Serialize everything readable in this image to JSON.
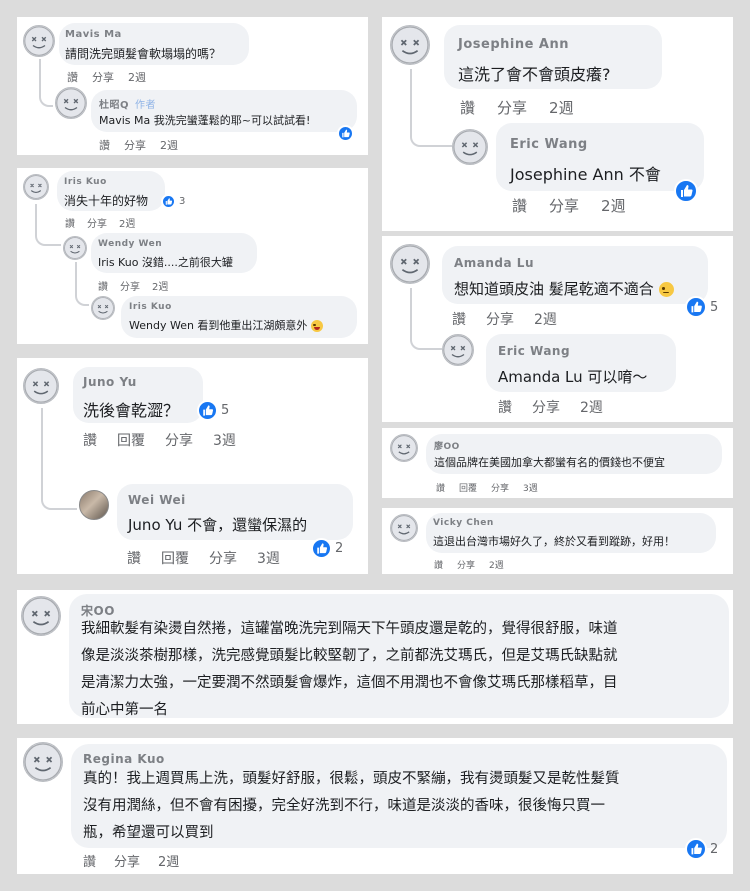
{
  "colors": {
    "accent": "#1877f2",
    "bubble": "#f0f2f5",
    "muted": "#65676b",
    "background": "#dcdcdc"
  },
  "icons": {
    "avatar": "default-avatar-icon",
    "like": "thumbs-up-icon",
    "haha": "laughing-emoji-icon",
    "sad": "sad-emoji-icon"
  },
  "card1": {
    "c1": {
      "name": "Mavis Ma",
      "text": "請問洗完頭髮會軟塌塌的嗎？",
      "like": "讚",
      "share": "分享",
      "time": "2週"
    },
    "c2": {
      "name": "杜昭Q",
      "tag": "作者",
      "text": "Mavis Ma 我洗完蠻蓬鬆的耶~可以試試看!",
      "like": "讚",
      "share": "分享",
      "time": "2週"
    }
  },
  "card2": {
    "c1": {
      "name": "Iris Kuo",
      "text": "消失十年的好物",
      "count": "3",
      "like": "讚",
      "share": "分享",
      "time": "2週"
    },
    "c2": {
      "name": "Wendy Wen",
      "text": "Iris Kuo 沒錯....之前很大罐",
      "like": "讚",
      "share": "分享",
      "time": "2週"
    },
    "c3": {
      "name": "Iris Kuo",
      "text": "Wendy Wen 看到他重出江湖頗意外"
    }
  },
  "card3": {
    "c1": {
      "name": "Juno Yu",
      "text": "洗後會乾澀？",
      "count": "5",
      "like": "讚",
      "reply": "回覆",
      "share": "分享",
      "time": "3週"
    },
    "c2": {
      "name": "Wei Wei",
      "text": "Juno Yu 不會，還蠻保濕的",
      "count": "2",
      "like": "讚",
      "reply": "回覆",
      "share": "分享",
      "time": "3週"
    }
  },
  "card4": {
    "c1": {
      "name": "Josephine Ann",
      "text": "這洗了會不會頭皮癢?",
      "like": "讚",
      "share": "分享",
      "time": "2週"
    },
    "c2": {
      "name": "Eric Wang",
      "text": "Josephine Ann 不會",
      "like": "讚",
      "share": "分享",
      "time": "2週"
    }
  },
  "card5": {
    "c1": {
      "name": "Amanda Lu",
      "text": "想知道頭皮油 髮尾乾適不適合",
      "count": "5",
      "like": "讚",
      "share": "分享",
      "time": "2週"
    },
    "c2": {
      "name": "Eric Wang",
      "text": "Amanda Lu 可以唷～",
      "like": "讚",
      "share": "分享",
      "time": "2週"
    }
  },
  "card6": {
    "c1": {
      "name": "廖OO",
      "text": "這個品牌在美國加拿大都蠻有名的價錢也不便宜",
      "like": "讚",
      "reply": "回覆",
      "share": "分享",
      "time": "3週"
    }
  },
  "card7": {
    "c1": {
      "name": "Vicky Chen",
      "text": "這退出台灣市場好久了，終於又看到蹤跡，好用！",
      "like": "讚",
      "share": "分享",
      "time": "2週"
    }
  },
  "card8": {
    "c1": {
      "name": "宋OO",
      "line1": "我細軟髮有染燙自然捲，這罐當晚洗完到隔天下午頭皮還是乾的，覺得很舒服，味道",
      "line2": "像是淡淡茶樹那樣，洗完感覺頭髮比較堅韌了，之前都洗艾瑪氏，但是艾瑪氏缺點就",
      "line3": "是清潔力太強，一定要潤不然頭髮會爆炸，這個不用潤也不會像艾瑪氏那樣稻草，目",
      "line4": "前心中第一名"
    }
  },
  "card9": {
    "c1": {
      "name": "Regina Kuo",
      "line1": "真的！我上週買馬上洗，頭髮好舒服，很鬆，頭皮不緊繃，我有燙頭髮又是乾性髮質",
      "line2": "沒有用潤絲，但不會有困擾，完全好洗到不行，味道是淡淡的香味，很後悔只買一",
      "line3": "瓶，希望還可以買到",
      "count": "2",
      "like": "讚",
      "share": "分享",
      "time": "2週"
    }
  }
}
